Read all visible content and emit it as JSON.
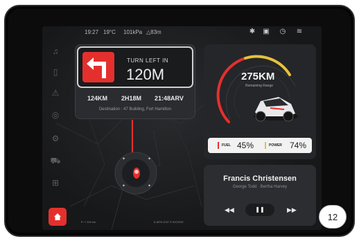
{
  "status_bar": {
    "time": "19:27",
    "temperature": "19°C",
    "pressure": "101kPa",
    "altitude": "△83m",
    "icons": [
      "bluetooth-icon",
      "phone-icon",
      "compass-icon",
      "wifi-icon"
    ]
  },
  "sidebar": {
    "items": [
      "music-icon",
      "phone-icon",
      "car-icon",
      "camera-icon",
      "settings-icon",
      "vehicle-icon",
      "grid-icon"
    ],
    "home_icon": "home-icon"
  },
  "navigation": {
    "instruction": "TURN LEFT IN",
    "distance": "120M",
    "trip_distance": "124KM",
    "trip_time": "2H18M",
    "arrival": "21:48ARV",
    "destination": "Destination : 47 Building, Fort Hamilton"
  },
  "range": {
    "value": "275KM",
    "label": "Remaining Range",
    "fuel_label": "FUEL",
    "fuel_value": "45%",
    "power_label": "POWER",
    "power_value": "74%"
  },
  "music": {
    "title": "Francis Christensen",
    "artist": "George Todd · Bertha Harvey",
    "prev_icon": "rewind-icon",
    "play_icon": "pause-icon",
    "next_icon": "fast-forward-icon"
  },
  "map": {
    "scale": "100 km",
    "coords": "6.38°N 5'00\" E 59'25'00\""
  },
  "badge": "12",
  "colors": {
    "accent_red": "#e4302d",
    "accent_yellow": "#e6c23a",
    "background": "#17181a"
  }
}
